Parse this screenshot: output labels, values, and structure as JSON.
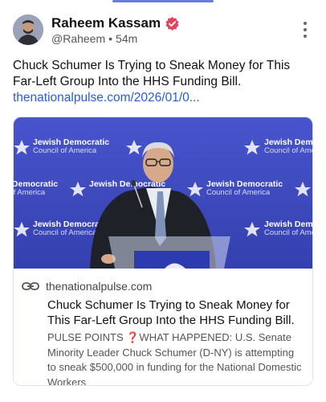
{
  "post": {
    "author_name": "Raheem Kassam",
    "handle": "@Raheem",
    "separator": "•",
    "time": "54m",
    "text": "Chuck Schumer Is Trying to Sneak Money for This Far-Left Group Into the HHS Funding Bill.",
    "link_text": "thenationalpulse.com/2026/01/0..."
  },
  "card": {
    "image_banner": {
      "line1": "Jewish Democratic",
      "line2": "Council of America"
    },
    "domain": "thenationalpulse.com",
    "title": "Chuck Schumer Is Trying to Sneak Money for This Far-Left Group Into the HHS Funding Bill.",
    "description": "PULSE POINTS ❓WHAT HAPPENED: U.S. Senate Minority Leader Chuck Schumer (D-NY) is attempting to sneak $500,000 in funding for the National Domestic Workers"
  },
  "colors": {
    "link": "#2a5bd7",
    "verified": "#e8405e",
    "backdrop": "#3b47c4"
  },
  "icons": {
    "verified": "verified-badge-icon",
    "more": "more-vertical-icon",
    "link": "link-icon",
    "star": "star-icon"
  }
}
